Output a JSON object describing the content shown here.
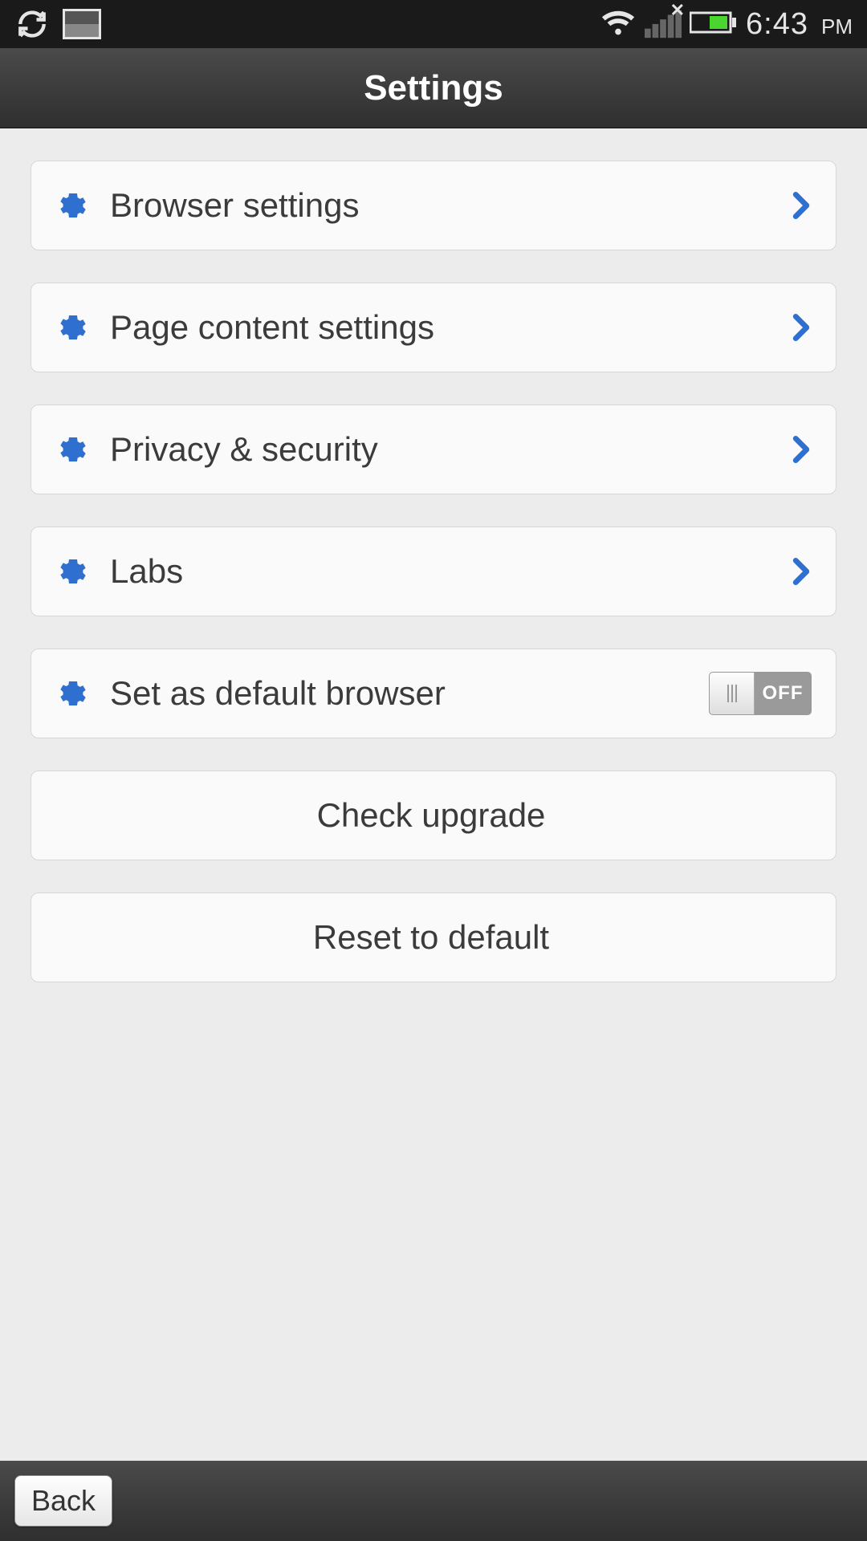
{
  "status": {
    "time": "6:43",
    "ampm": "PM"
  },
  "header": {
    "title": "Settings"
  },
  "rows": {
    "browser": "Browser settings",
    "page_content": "Page content settings",
    "privacy": "Privacy & security",
    "labs": "Labs",
    "default_browser": "Set as default browser",
    "default_browser_toggle": "OFF",
    "check_upgrade": "Check upgrade",
    "reset": "Reset to default"
  },
  "footer": {
    "back": "Back"
  }
}
